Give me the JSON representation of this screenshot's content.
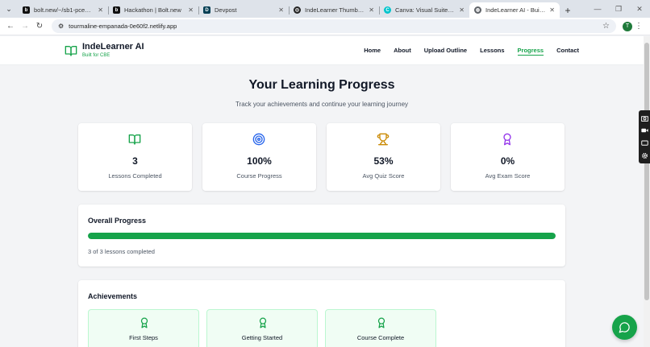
{
  "browser": {
    "tabs": [
      {
        "label": "bolt.new/~/sb1-pcew3bwq",
        "fav": "bolt",
        "color": "#111111"
      },
      {
        "label": "Hackathon | Bolt.new",
        "fav": "bolt",
        "color": "#111111"
      },
      {
        "label": "Devpost",
        "fav": "devpost",
        "color": "#003e54"
      },
      {
        "label": "IndeLearner Thumbnail Des",
        "fav": "ideogram",
        "color": "#222222"
      },
      {
        "label": "Canva: Visual Suite for Ever",
        "fav": "canva",
        "color": "#00c4cc"
      },
      {
        "label": "IndeLearner AI - Built for C",
        "fav": "globe",
        "color": "#5f6368",
        "active": true
      }
    ],
    "new_tab": "+",
    "url": "tourmaline-empanada-0e60f2.netlify.app",
    "profile_initial": "T"
  },
  "header": {
    "brand_name": "IndeLearner AI",
    "brand_tagline": "Built for CBE",
    "nav": [
      {
        "label": "Home",
        "active": false
      },
      {
        "label": "About",
        "active": false
      },
      {
        "label": "Upload Outline",
        "active": false
      },
      {
        "label": "Lessons",
        "active": false
      },
      {
        "label": "Progress",
        "active": true
      },
      {
        "label": "Contact",
        "active": false
      }
    ]
  },
  "main": {
    "title": "Your Learning Progress",
    "subtitle": "Track your achievements and continue your learning journey",
    "stats": [
      {
        "value": "3",
        "label": "Lessons Completed",
        "icon": "book-icon",
        "color": "#16a34a"
      },
      {
        "value": "100%",
        "label": "Course Progress",
        "icon": "target-icon",
        "color": "#2563eb"
      },
      {
        "value": "53%",
        "label": "Avg Quiz Score",
        "icon": "trophy-icon",
        "color": "#ca8a04"
      },
      {
        "value": "0%",
        "label": "Avg Exam Score",
        "icon": "award-icon",
        "color": "#9333ea"
      }
    ],
    "overall": {
      "title": "Overall Progress",
      "fraction": 1.0,
      "text": "3 of 3 lessons completed"
    },
    "achievements": {
      "title": "Achievements",
      "items": [
        {
          "label": "First Steps",
          "icon": "award-icon"
        },
        {
          "label": "Getting Started",
          "icon": "award-icon"
        },
        {
          "label": "Course Complete",
          "icon": "award-icon"
        }
      ]
    }
  },
  "colors": {
    "accent": "#16a34a",
    "chat_button": "#16a34a"
  }
}
